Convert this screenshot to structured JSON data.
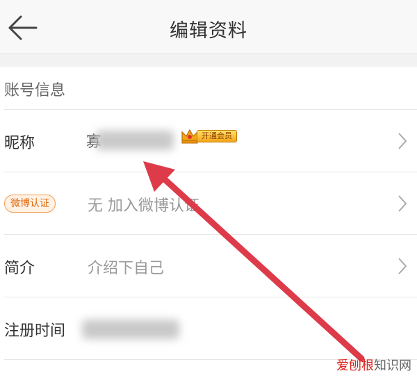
{
  "header": {
    "title": "编辑资料",
    "back_icon": "arrow-left-icon"
  },
  "section": {
    "title": "账号信息"
  },
  "rows": {
    "nickname": {
      "label": "昵称",
      "value_partial": "寡",
      "vip_badge": "开通会员"
    },
    "weibo": {
      "badge": "微博认证",
      "value": "无 加入微博认证"
    },
    "intro": {
      "label": "简介",
      "value": "介绍下自己"
    },
    "register": {
      "label": "注册时间"
    }
  },
  "watermark": {
    "red_part": "爱刨根",
    "rest": "知识网"
  },
  "colors": {
    "annotation_arrow": "#dd3b4a",
    "vip_gold": "#f4a51a",
    "weibo_orange": "#e06a10"
  }
}
